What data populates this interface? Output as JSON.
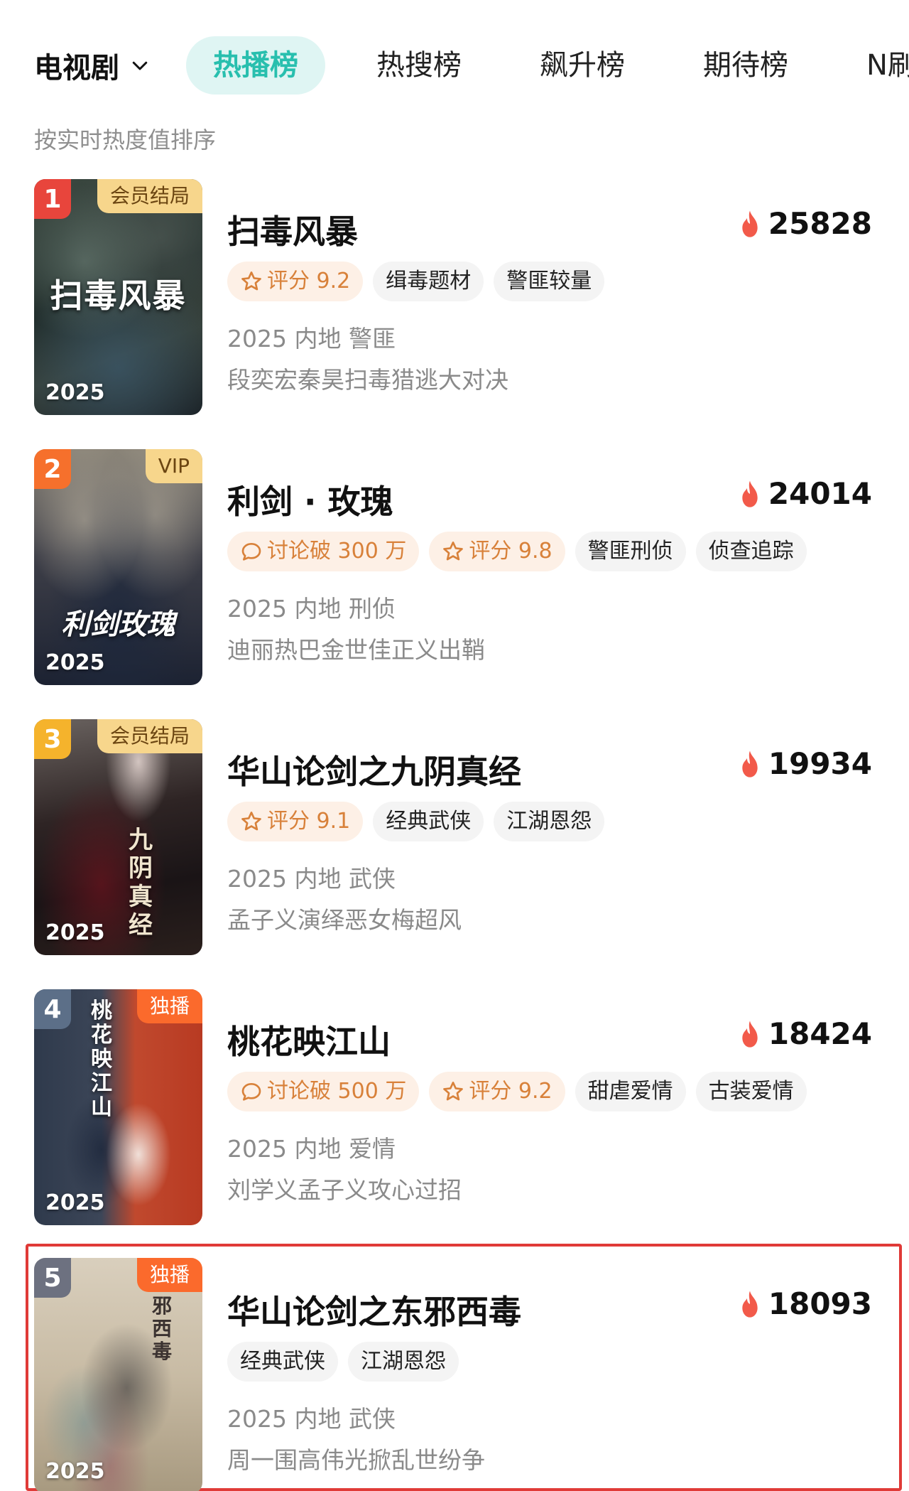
{
  "tabbar": {
    "category": "电视剧",
    "tabs": [
      {
        "label": "热播榜",
        "active": true
      },
      {
        "label": "热搜榜",
        "active": false
      },
      {
        "label": "飙升榜",
        "active": false
      },
      {
        "label": "期待榜",
        "active": false
      },
      {
        "label": "N刷榜",
        "active": false
      }
    ]
  },
  "sort_hint": "按实时热度值排序",
  "colors": {
    "accent": "#28bfae",
    "accent_bg": "#dff5f3",
    "flame": "#f25a4a",
    "tag_highlight_text": "#d8813a",
    "tag_highlight_bg": "#fdf0e6",
    "highlight_border": "#e03a37"
  },
  "items": [
    {
      "rank": "1",
      "rank_color": "#e8453c",
      "badge": "会员结局",
      "badge_style": "gold",
      "poster_year": "2025",
      "poster_title": "扫毒风暴",
      "title": "扫毒风暴",
      "heat": "25828",
      "tags": [
        {
          "icon": "star-icon",
          "label": "评分 9.2",
          "style": "hl"
        },
        {
          "label": "缉毒题材",
          "style": "plain"
        },
        {
          "label": "警匪较量",
          "style": "plain"
        }
      ],
      "meta": "2025 内地 警匪",
      "desc": "段奕宏秦昊扫毒猎逃大对决",
      "highlighted": false
    },
    {
      "rank": "2",
      "rank_color": "#f6702c",
      "badge": "VIP",
      "badge_style": "gold",
      "poster_year": "2025",
      "poster_title": "利剑玫瑰",
      "title": "利剑 · 玫瑰",
      "heat": "24014",
      "tags": [
        {
          "icon": "comment-icon",
          "label": "讨论破 300 万",
          "style": "hl"
        },
        {
          "icon": "star-icon",
          "label": "评分 9.8",
          "style": "hl"
        },
        {
          "label": "警匪刑侦",
          "style": "plain"
        },
        {
          "label": "侦查追踪",
          "style": "plain"
        }
      ],
      "meta": "2025 内地 刑侦",
      "desc": "迪丽热巴金世佳正义出鞘",
      "highlighted": false
    },
    {
      "rank": "3",
      "rank_color": "#f5b32c",
      "badge": "会员结局",
      "badge_style": "gold",
      "poster_year": "2025",
      "poster_title": "九阴真经",
      "title": "华山论剑之九阴真经",
      "heat": "19934",
      "tags": [
        {
          "icon": "star-icon",
          "label": "评分 9.1",
          "style": "hl"
        },
        {
          "label": "经典武侠",
          "style": "plain"
        },
        {
          "label": "江湖恩怨",
          "style": "plain"
        }
      ],
      "meta": "2025 内地 武侠",
      "desc": "孟子义演绎恶女梅超风",
      "highlighted": false
    },
    {
      "rank": "4",
      "rank_color": "#5c6f88",
      "badge": "独播",
      "badge_style": "orange",
      "poster_year": "2025",
      "poster_title": "桃花映江山",
      "title": "桃花映江山",
      "heat": "18424",
      "tags": [
        {
          "icon": "comment-icon",
          "label": "讨论破 500 万",
          "style": "hl"
        },
        {
          "icon": "star-icon",
          "label": "评分 9.2",
          "style": "hl"
        },
        {
          "label": "甜虐爱情",
          "style": "plain"
        },
        {
          "label": "古装爱情",
          "style": "plain"
        }
      ],
      "meta": "2025 内地 爱情",
      "desc": "刘学义孟子义攻心过招",
      "highlighted": false
    },
    {
      "rank": "5",
      "rank_color": "#6d7180",
      "badge": "独播",
      "badge_style": "orange",
      "poster_year": "2025",
      "poster_title": "东邪西毒",
      "title": "华山论剑之东邪西毒",
      "heat": "18093",
      "tags": [
        {
          "label": "经典武侠",
          "style": "plain"
        },
        {
          "label": "江湖恩怨",
          "style": "plain"
        }
      ],
      "meta": "2025 内地 武侠",
      "desc": "周一围高伟光掀乱世纷争",
      "highlighted": true
    }
  ]
}
